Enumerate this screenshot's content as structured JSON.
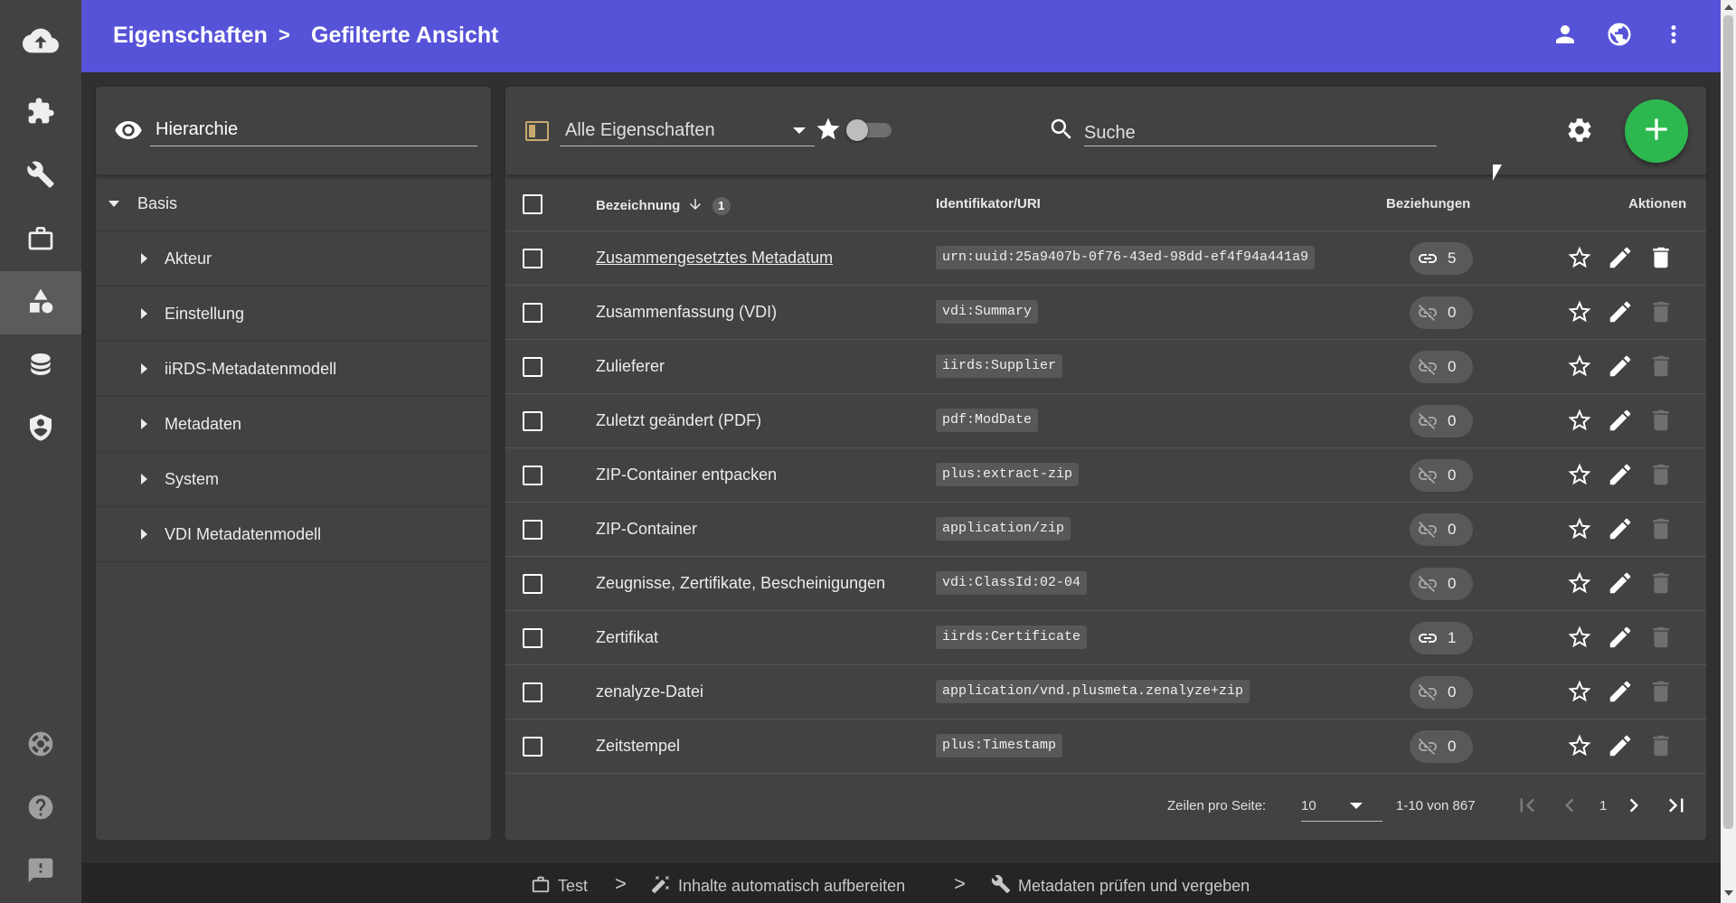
{
  "header": {
    "breadcrumb_1": "Eigenschaften",
    "breadcrumb_sep": ">",
    "breadcrumb_2": "Gefilterte Ansicht",
    "accent_color": "#5653d8"
  },
  "rail": {
    "items": [
      {
        "icon": "cloud-upload-icon"
      },
      {
        "icon": "puzzle-icon"
      },
      {
        "icon": "wrench-icon"
      },
      {
        "icon": "briefcase-icon"
      },
      {
        "icon": "shapes-icon",
        "active": true
      },
      {
        "icon": "database-icon"
      },
      {
        "icon": "shield-account-icon"
      },
      {
        "icon": "lifebuoy-icon"
      },
      {
        "icon": "help-circle-icon"
      },
      {
        "icon": "feedback-icon"
      }
    ]
  },
  "hierarchy": {
    "select_value": "Hierarchie",
    "tree": {
      "root": "Basis",
      "children": [
        "Akteur",
        "Einstellung",
        "iiRDS-Metadatenmodell",
        "Metadaten",
        "System",
        "VDI Metadatenmodell"
      ]
    }
  },
  "toolbar": {
    "filter_value": "Alle Eigenschaften",
    "search_placeholder": "Suche",
    "add_button_color": "#2db84f"
  },
  "table": {
    "columns": {
      "name": "Bezeichnung",
      "sort_order": "1",
      "uri": "Identifikator/URI",
      "relations": "Beziehungen",
      "actions": "Aktionen"
    },
    "rows": [
      {
        "name": "Zusammengesetztes Metadatum",
        "uri": "urn:uuid:25a9407b-0f76-43ed-98dd-ef4f94a441a9",
        "relations": "5",
        "linked": true,
        "link_style": true,
        "deletable": true
      },
      {
        "name": "Zusammenfassung (VDI)",
        "uri": "vdi:Summary",
        "relations": "0",
        "linked": false,
        "link_style": false,
        "deletable": false
      },
      {
        "name": "Zulieferer",
        "uri": "iirds:Supplier",
        "relations": "0",
        "linked": false,
        "link_style": false,
        "deletable": false
      },
      {
        "name": "Zuletzt geändert (PDF)",
        "uri": "pdf:ModDate",
        "relations": "0",
        "linked": false,
        "link_style": false,
        "deletable": false
      },
      {
        "name": "ZIP-Container entpacken",
        "uri": "plus:extract-zip",
        "relations": "0",
        "linked": false,
        "link_style": false,
        "deletable": false
      },
      {
        "name": "ZIP-Container",
        "uri": "application/zip",
        "relations": "0",
        "linked": false,
        "link_style": false,
        "deletable": false
      },
      {
        "name": "Zeugnisse, Zertifikate, Bescheinigungen",
        "uri": "vdi:ClassId:02-04",
        "relations": "0",
        "linked": false,
        "link_style": false,
        "deletable": false
      },
      {
        "name": "Zertifikat",
        "uri": "iirds:Certificate",
        "relations": "1",
        "linked": true,
        "link_style": false,
        "deletable": false
      },
      {
        "name": "zenalyze-Datei",
        "uri": "application/vnd.plusmeta.zenalyze+zip",
        "relations": "0",
        "linked": false,
        "link_style": false,
        "deletable": false
      },
      {
        "name": "Zeitstempel",
        "uri": "plus:Timestamp",
        "relations": "0",
        "linked": false,
        "link_style": false,
        "deletable": false
      }
    ]
  },
  "pagination": {
    "rows_label": "Zeilen pro Seite:",
    "rows_value": "10",
    "range": "1-10 von 867",
    "page": "1"
  },
  "footer": {
    "steps": [
      "Test",
      "Inhalte automatisch aufbereiten",
      "Metadaten prüfen und vergeben"
    ],
    "sep": ">"
  }
}
